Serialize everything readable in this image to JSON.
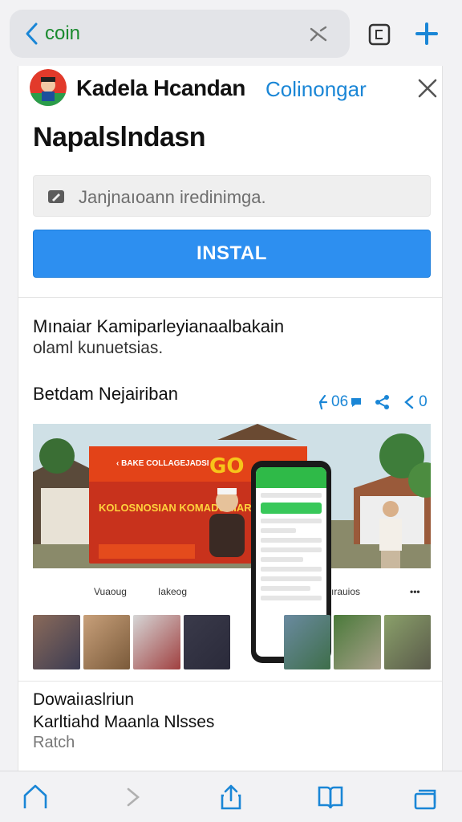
{
  "browser": {
    "url_text": "coin"
  },
  "app": {
    "name": "Kadela Hcandan",
    "developer": "Colinongar",
    "headline": "Napalslndasn"
  },
  "search": {
    "placeholder": "Janjnaıoann iredinimga."
  },
  "install": {
    "label": "INSTAL"
  },
  "description": {
    "line1": "Mınaiar Kamiparleyianaalbakain",
    "line2": "olaml kunuetsias."
  },
  "gallery_section": {
    "title": "Betdam Nejairiban",
    "stats": {
      "likes": "06",
      "share_icon": "share-icon",
      "count": "0"
    }
  },
  "screenshot": {
    "go_text": "GO",
    "red_heading": "KOLOSNOSIAN KOMADUAIAR",
    "caption_left": "Vuaoug",
    "caption_mid": "Iakeog",
    "caption_right": "ırauios"
  },
  "footer": {
    "line1": "Dowaiıaslriun",
    "line2": "Karltiahd Maanla Nlsses",
    "line3": "Ratch"
  },
  "colors": {
    "accent": "#2d8ff0",
    "link": "#1a86d6",
    "url_green": "#1a8a2e"
  }
}
